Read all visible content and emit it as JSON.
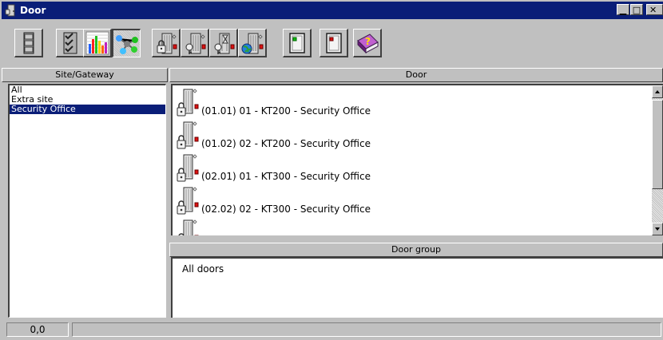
{
  "window": {
    "title": "Door",
    "title_icon": "door-app-icon",
    "controls": [
      "minimize",
      "maximize",
      "close"
    ]
  },
  "toolbar": {
    "buttons": [
      {
        "name": "cabinet",
        "icon": "cabinet-icon"
      },
      {
        "name": "checklist",
        "icon": "checklist-icon"
      },
      {
        "name": "chart",
        "icon": "bar-chart-icon"
      },
      {
        "name": "network",
        "icon": "network-icon",
        "pressed": true
      },
      {
        "name": "door-lock",
        "icon": "door-lock-icon"
      },
      {
        "name": "door-key",
        "icon": "door-key-icon"
      },
      {
        "name": "door-timer",
        "icon": "door-hourglass-icon"
      },
      {
        "name": "door-globe",
        "icon": "door-globe-icon"
      },
      {
        "name": "door-green",
        "icon": "door-green-icon"
      },
      {
        "name": "door-red",
        "icon": "door-red-icon"
      },
      {
        "name": "help",
        "icon": "help-book-icon"
      }
    ]
  },
  "site_panel": {
    "header": "Site/Gateway",
    "items": [
      {
        "label": "All",
        "selected": false
      },
      {
        "label": "Extra site",
        "selected": false
      },
      {
        "label": "Security Office",
        "selected": true
      }
    ]
  },
  "door_panel": {
    "header": "Door",
    "items": [
      {
        "label": "(01.01) 01 - KT200 - Security Office"
      },
      {
        "label": "(01.02) 02 - KT200 - Security Office"
      },
      {
        "label": "(02.01) 01 - KT300 - Security Office"
      },
      {
        "label": "(02.02) 02 - KT300 - Security Office"
      }
    ]
  },
  "group_panel": {
    "header": "Door group",
    "items": [
      {
        "label": "All doors"
      }
    ]
  },
  "status": {
    "coords": "0,0"
  },
  "colors": {
    "titlebar": "#0a1e78",
    "selection": "#0a1e78",
    "face": "#c0c0c0"
  }
}
